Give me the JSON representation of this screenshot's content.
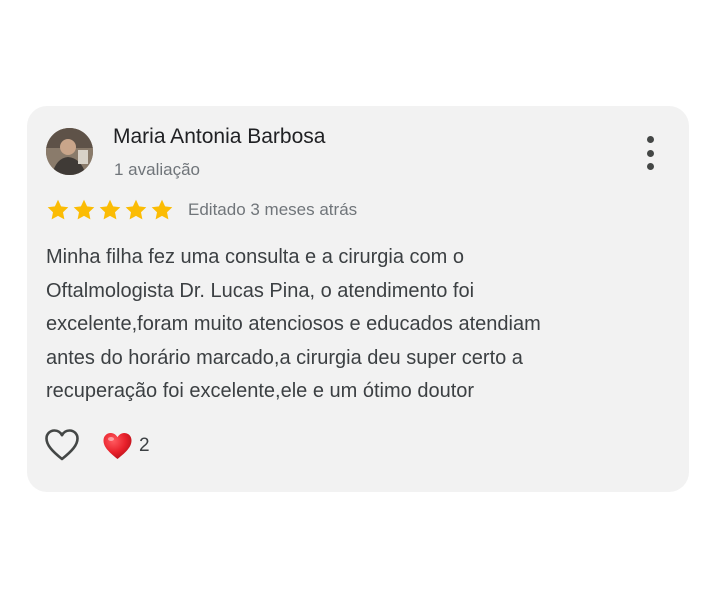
{
  "review": {
    "author_name": "Maria Antonia Barbosa",
    "author_reviews": "1 avaliação",
    "rating": 5,
    "rating_max": 5,
    "edited_label": "Editado 3 meses atrás",
    "text_lines": [
      "Minha filha fez uma consulta e a cirurgia com o",
      "Oftalmologista Dr. Lucas Pina, o atendimento foi",
      "excelente,foram muito atenciosos e educados atendiam",
      "antes do horário marcado,a cirurgia deu super certo a",
      "recuperação foi excelente,ele e um ótimo doutor"
    ],
    "reaction_count": "2"
  },
  "icons": {
    "avatar": "user-photo",
    "more": "more-vert-icon",
    "star": "star-icon",
    "like": "heart-outline-icon",
    "reaction": "red-heart-icon"
  },
  "colors": {
    "card_background": "#f2f2f2",
    "star": "#fbbc04",
    "heart_reaction": "#e8202a",
    "primary_text": "#202124",
    "secondary_text": "#70757a"
  }
}
